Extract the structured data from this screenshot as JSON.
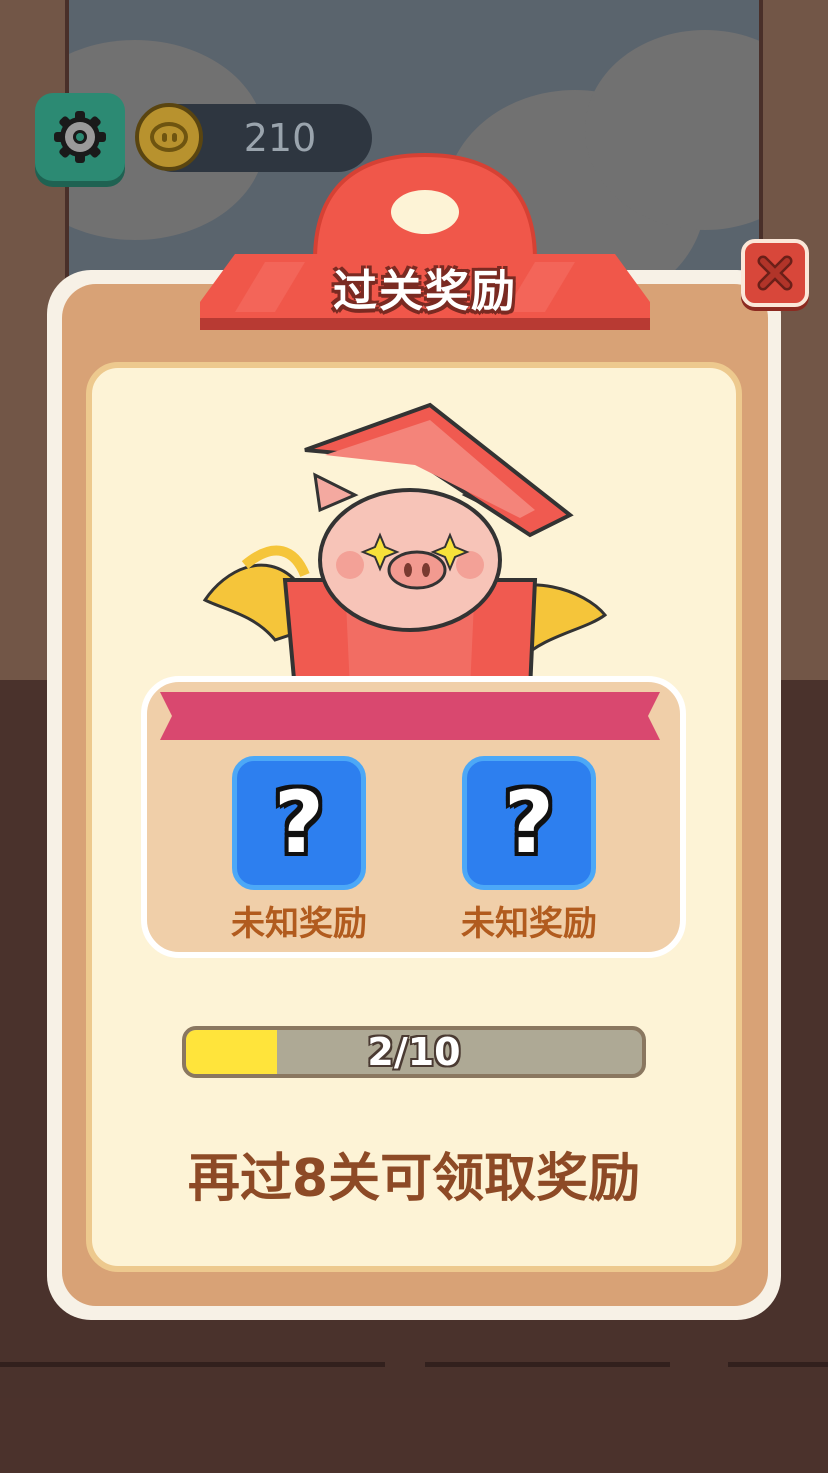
{
  "hud": {
    "coins": "210",
    "icons": {
      "settings": "gear-icon",
      "coin": "pig-coin-icon"
    }
  },
  "dialog": {
    "title": "过关奖励",
    "close_icon": "close-icon",
    "rewards": [
      {
        "icon": "question-mark-icon",
        "symbol": "?",
        "label": "未知奖励"
      },
      {
        "icon": "question-mark-icon",
        "symbol": "?",
        "label": "未知奖励"
      }
    ],
    "progress": {
      "current": 2,
      "total": 10,
      "text": "2/10"
    },
    "hint": "再过8关可领取奖励"
  },
  "colors": {
    "accent_red": "#d8473a",
    "panel_tan": "#d8a276",
    "card_cream": "#fdf3d6",
    "reward_blue": "#2d7fef",
    "progress_yellow": "#ffe43b",
    "label_brown": "#b15b1e"
  }
}
